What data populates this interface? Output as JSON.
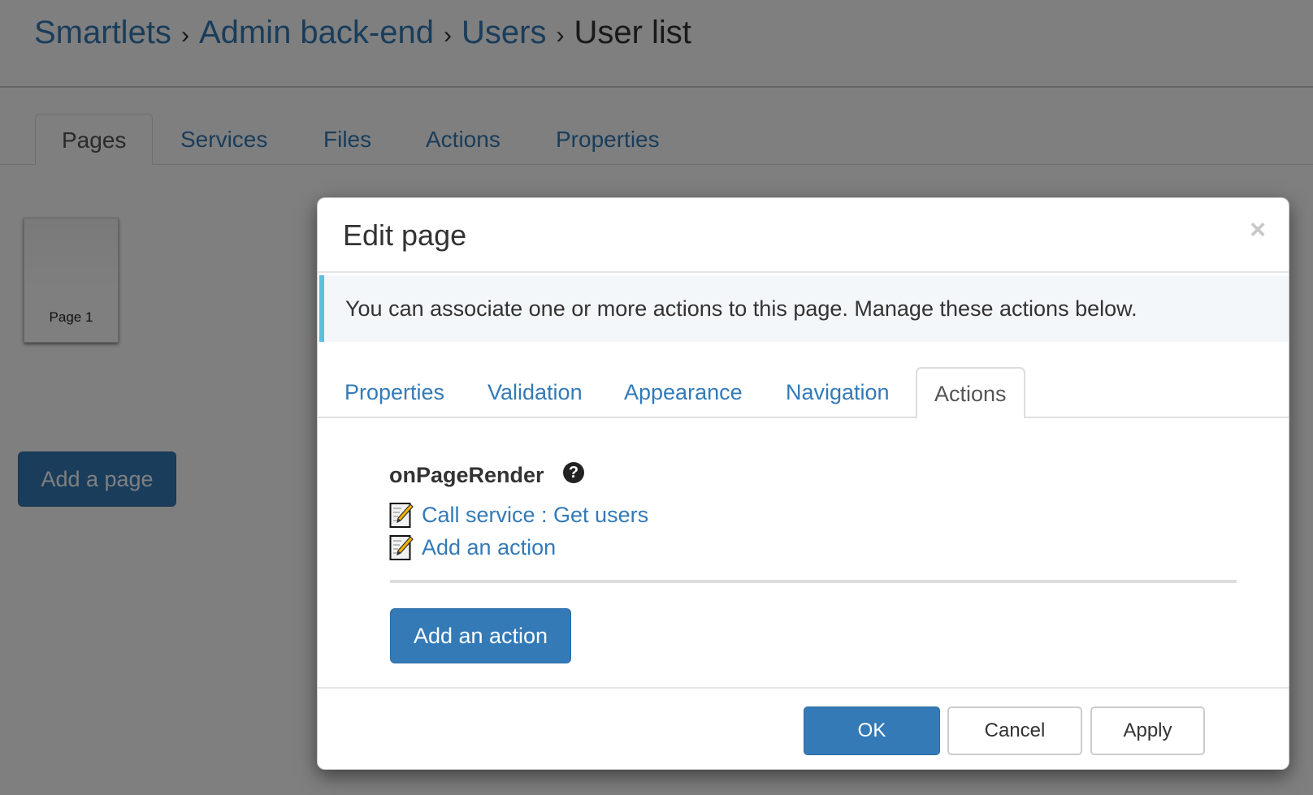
{
  "breadcrumb": {
    "items": [
      "Smartlets",
      "Admin back-end",
      "Users"
    ],
    "separator": "›",
    "current": "User list"
  },
  "main_tabs": [
    {
      "label": "Pages",
      "active": true
    },
    {
      "label": "Services",
      "active": false
    },
    {
      "label": "Files",
      "active": false
    },
    {
      "label": "Actions",
      "active": false
    },
    {
      "label": "Properties",
      "active": false
    }
  ],
  "pages": [
    {
      "label": "Page 1"
    }
  ],
  "add_page_button": "Add a page",
  "modal": {
    "title": "Edit page",
    "close_icon": "×",
    "info_message": "You can associate one or more actions to this page. Manage these actions below.",
    "tabs": [
      {
        "label": "Properties",
        "active": false
      },
      {
        "label": "Validation",
        "active": false
      },
      {
        "label": "Appearance",
        "active": false
      },
      {
        "label": "Navigation",
        "active": false
      },
      {
        "label": "Actions",
        "active": true
      }
    ],
    "event": {
      "name": "onPageRender",
      "help_icon": "?",
      "actions": [
        {
          "label": "Call service : Get users",
          "icon": "edit-document-icon"
        },
        {
          "label": "Add an action",
          "icon": "edit-document-icon"
        }
      ]
    },
    "add_action_button": "Add an action",
    "footer": {
      "ok": "OK",
      "cancel": "Cancel",
      "apply": "Apply"
    }
  },
  "colors": {
    "primary": "#337ab7",
    "info_border": "#5bc0de",
    "info_bg": "#f4f7fa"
  }
}
